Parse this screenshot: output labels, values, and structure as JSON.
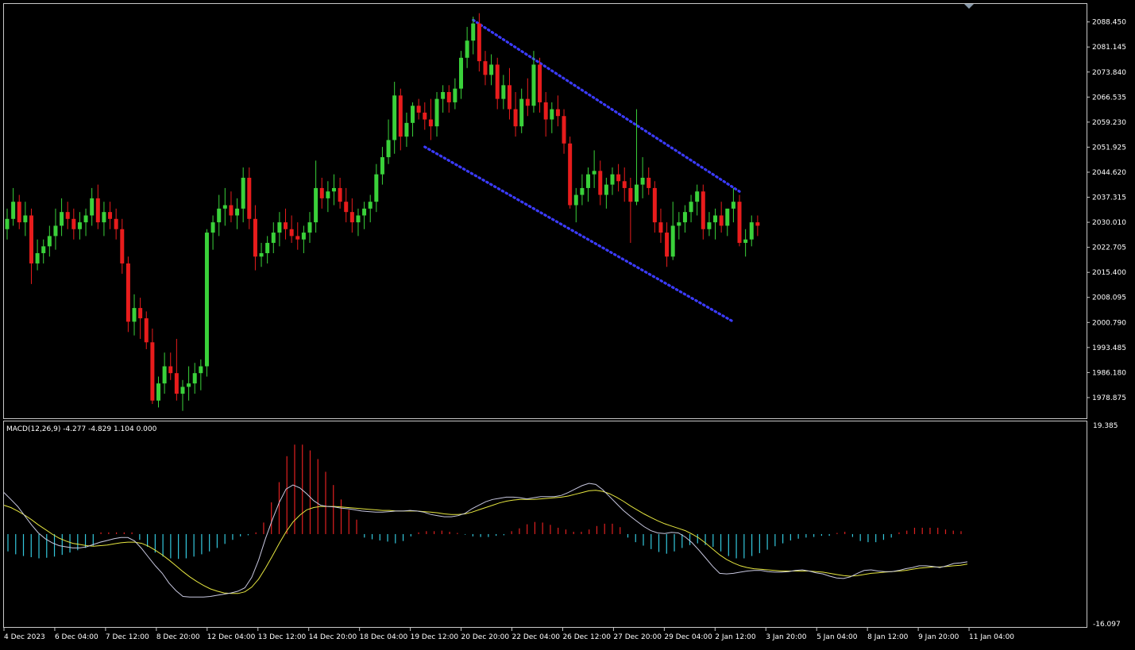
{
  "chart_data": [
    {
      "type": "candlestick",
      "symbol_panel": "price",
      "ylim": [
        1974.0,
        2093.0
      ],
      "y_ticks": [
        "2088.450",
        "2081.145",
        "2073.840",
        "2066.535",
        "2059.230",
        "2051.925",
        "2044.620",
        "2037.315",
        "2030.010",
        "2022.705",
        "2015.400",
        "2008.095",
        "2000.790",
        "1993.485",
        "1986.180",
        "1978.875"
      ],
      "x_labels": [
        "4 Dec 2023",
        "6 Dec 04:00",
        "7 Dec 12:00",
        "8 Dec 20:00",
        "12 Dec 04:00",
        "13 Dec 12:00",
        "14 Dec 20:00",
        "18 Dec 04:00",
        "19 Dec 12:00",
        "20 Dec 20:00",
        "22 Dec 04:00",
        "26 Dec 12:00",
        "27 Dec 20:00",
        "29 Dec 04:00",
        "2 Jan 12:00",
        "3 Jan 20:00",
        "5 Jan 04:00",
        "8 Jan 12:00",
        "9 Jan 20:00",
        "11 Jan 04:00"
      ],
      "bull_color": "#3ad13a",
      "bear_color": "#e81c1c",
      "ohlc": [
        [
          2028,
          2034,
          2025,
          2031
        ],
        [
          2031,
          2040,
          2029,
          2036
        ],
        [
          2036,
          2038,
          2028,
          2030
        ],
        [
          2030,
          2036,
          2026,
          2032
        ],
        [
          2032,
          2034,
          2012,
          2018
        ],
        [
          2018,
          2025,
          2016,
          2021
        ],
        [
          2021,
          2025,
          2018,
          2023
        ],
        [
          2023,
          2029,
          2020,
          2026
        ],
        [
          2026,
          2034,
          2022,
          2029
        ],
        [
          2029,
          2037,
          2026,
          2033
        ],
        [
          2033,
          2036,
          2028,
          2031
        ],
        [
          2031,
          2034,
          2025,
          2028
        ],
        [
          2028,
          2033,
          2025,
          2030
        ],
        [
          2030,
          2034,
          2026,
          2032
        ],
        [
          2032,
          2040,
          2029,
          2037
        ],
        [
          2037,
          2041,
          2028,
          2030
        ],
        [
          2030,
          2036,
          2026,
          2033
        ],
        [
          2033,
          2036,
          2028,
          2031
        ],
        [
          2031,
          2034,
          2025,
          2028
        ],
        [
          2028,
          2031,
          2015,
          2018
        ],
        [
          2018,
          2020,
          1998,
          2001
        ],
        [
          2001,
          2009,
          1997,
          2005
        ],
        [
          2005,
          2008,
          1996,
          2002
        ],
        [
          2002,
          2004,
          1993,
          1995
        ],
        [
          1995,
          1999,
          1977,
          1978
        ],
        [
          1978,
          1985,
          1976,
          1983
        ],
        [
          1983,
          1992,
          1980,
          1988
        ],
        [
          1988,
          1992,
          1984,
          1986
        ],
        [
          1986,
          1996,
          1978,
          1980
        ],
        [
          1980,
          1984,
          1975,
          1982
        ],
        [
          1982,
          1988,
          1978,
          1983
        ],
        [
          1983,
          1989,
          1980,
          1986
        ],
        [
          1986,
          1990,
          1981,
          1988
        ],
        [
          1988,
          2028,
          1985,
          2027
        ],
        [
          2027,
          2032,
          2022,
          2030
        ],
        [
          2030,
          2038,
          2026,
          2034
        ],
        [
          2034,
          2040,
          2029,
          2035
        ],
        [
          2035,
          2039,
          2030,
          2032
        ],
        [
          2032,
          2037,
          2028,
          2034
        ],
        [
          2034,
          2046,
          2030,
          2043
        ],
        [
          2043,
          2046,
          2028,
          2031
        ],
        [
          2031,
          2035,
          2016,
          2020
        ],
        [
          2020,
          2024,
          2017,
          2021
        ],
        [
          2021,
          2026,
          2018,
          2024
        ],
        [
          2024,
          2030,
          2021,
          2027
        ],
        [
          2027,
          2033,
          2023,
          2030
        ],
        [
          2030,
          2034,
          2025,
          2028
        ],
        [
          2028,
          2032,
          2024,
          2026
        ],
        [
          2026,
          2030,
          2022,
          2025
        ],
        [
          2025,
          2029,
          2021,
          2027
        ],
        [
          2027,
          2033,
          2024,
          2030
        ],
        [
          2030,
          2048,
          2027,
          2040
        ],
        [
          2040,
          2043,
          2034,
          2037
        ],
        [
          2037,
          2042,
          2033,
          2039
        ],
        [
          2039,
          2044,
          2035,
          2040
        ],
        [
          2040,
          2043,
          2034,
          2036
        ],
        [
          2036,
          2040,
          2030,
          2033
        ],
        [
          2033,
          2037,
          2027,
          2030
        ],
        [
          2030,
          2034,
          2026,
          2032
        ],
        [
          2032,
          2036,
          2028,
          2034
        ],
        [
          2034,
          2038,
          2030,
          2036
        ],
        [
          2036,
          2047,
          2033,
          2044
        ],
        [
          2044,
          2052,
          2041,
          2049
        ],
        [
          2049,
          2060,
          2047,
          2054
        ],
        [
          2054,
          2071,
          2050,
          2067
        ],
        [
          2067,
          2069,
          2051,
          2055
        ],
        [
          2055,
          2062,
          2052,
          2059
        ],
        [
          2059,
          2065,
          2055,
          2064
        ],
        [
          2064,
          2066,
          2060,
          2062
        ],
        [
          2062,
          2065,
          2057,
          2060
        ],
        [
          2060,
          2066,
          2054,
          2058
        ],
        [
          2058,
          2068,
          2055,
          2066
        ],
        [
          2066,
          2070,
          2062,
          2068
        ],
        [
          2068,
          2070,
          2062,
          2065
        ],
        [
          2065,
          2072,
          2063,
          2069
        ],
        [
          2069,
          2080,
          2066,
          2078
        ],
        [
          2078,
          2087,
          2075,
          2083
        ],
        [
          2083,
          2090,
          2079,
          2088
        ],
        [
          2088,
          2091,
          2074,
          2077
        ],
        [
          2077,
          2080,
          2070,
          2073
        ],
        [
          2073,
          2079,
          2070,
          2076
        ],
        [
          2076,
          2078,
          2063,
          2066
        ],
        [
          2066,
          2073,
          2063,
          2070
        ],
        [
          2070,
          2075,
          2060,
          2063
        ],
        [
          2063,
          2068,
          2055,
          2058
        ],
        [
          2058,
          2069,
          2056,
          2066
        ],
        [
          2066,
          2072,
          2061,
          2064
        ],
        [
          2064,
          2080,
          2062,
          2076
        ],
        [
          2076,
          2078,
          2062,
          2065
        ],
        [
          2065,
          2068,
          2055,
          2060
        ],
        [
          2060,
          2065,
          2056,
          2063
        ],
        [
          2063,
          2067,
          2058,
          2061
        ],
        [
          2061,
          2063,
          2050,
          2053
        ],
        [
          2053,
          2055,
          2034,
          2035
        ],
        [
          2035,
          2040,
          2030,
          2038
        ],
        [
          2038,
          2044,
          2035,
          2040
        ],
        [
          2040,
          2046,
          2036,
          2044
        ],
        [
          2044,
          2051,
          2040,
          2045
        ],
        [
          2045,
          2048,
          2035,
          2038
        ],
        [
          2038,
          2043,
          2034,
          2041
        ],
        [
          2041,
          2046,
          2038,
          2044
        ],
        [
          2044,
          2047,
          2039,
          2042
        ],
        [
          2042,
          2046,
          2036,
          2040
        ],
        [
          2040,
          2043,
          2024,
          2036
        ],
        [
          2036,
          2063,
          2035,
          2041
        ],
        [
          2041,
          2049,
          2037,
          2043
        ],
        [
          2043,
          2046,
          2038,
          2040
        ],
        [
          2040,
          2042,
          2027,
          2030
        ],
        [
          2030,
          2034,
          2024,
          2027
        ],
        [
          2027,
          2030,
          2017,
          2020
        ],
        [
          2020,
          2036,
          2019,
          2029
        ],
        [
          2029,
          2033,
          2025,
          2030
        ],
        [
          2030,
          2035,
          2027,
          2033
        ],
        [
          2033,
          2038,
          2030,
          2036
        ],
        [
          2036,
          2041,
          2032,
          2039
        ],
        [
          2039,
          2041,
          2025,
          2028
        ],
        [
          2028,
          2033,
          2026,
          2030
        ],
        [
          2030,
          2034,
          2025,
          2032
        ],
        [
          2032,
          2036,
          2027,
          2029
        ],
        [
          2029,
          2033,
          2026,
          2034
        ],
        [
          2034,
          2040,
          2030,
          2036
        ],
        [
          2036,
          2038,
          2023,
          2024
        ],
        [
          2024,
          2028,
          2020,
          2025
        ],
        [
          2025,
          2032,
          2023,
          2030
        ],
        [
          2030,
          2032,
          2026,
          2029
        ]
      ],
      "channel": {
        "color": "#3b3bff",
        "upper": [
          [
            77,
            2089
          ],
          [
            121,
            2039
          ]
        ],
        "lower": [
          [
            69,
            2052
          ],
          [
            120,
            2001
          ]
        ]
      }
    },
    {
      "type": "macd",
      "title": "MACD(12,26,9) -4.277 -4.829 1.104 0.000",
      "ylim": [
        -16.097,
        19.385
      ],
      "y_top_label": "19.385",
      "y_bottom_label": "-16.097",
      "hist_pos_color": "#e02020",
      "hist_neg_color": "#33c8dd",
      "macd_line_color": "#c8c8e0",
      "signal_line_color": "#e6e640",
      "histogram": [
        -3.0,
        -3.5,
        -3.8,
        -4.0,
        -4.2,
        -4.1,
        -3.9,
        -3.6,
        -3.2,
        -2.8,
        -2.4,
        -2.0,
        0.3,
        0.3,
        0.3,
        0.3,
        0.3,
        -1.0,
        -2.2,
        -3.2,
        -3.9,
        -4.2,
        -4.3,
        -4.2,
        -3.9,
        -3.5,
        -3.0,
        -2.4,
        -1.7,
        -1.0,
        -0.4,
        -0.2,
        0.3,
        2.0,
        5.5,
        9.0,
        13.5,
        15.5,
        15.5,
        14.5,
        13.0,
        10.8,
        8.5,
        6.0,
        4.2,
        2.5,
        -0.6,
        -0.9,
        -1.1,
        -1.3,
        -1.6,
        -1.2,
        -0.4,
        0.3,
        0.5,
        0.5,
        0.6,
        0.4,
        0.2,
        -0.1,
        -0.4,
        -0.5,
        -0.5,
        -0.3,
        -0.2,
        0.5,
        1.0,
        1.7,
        2.1,
        2.0,
        1.6,
        1.1,
        0.8,
        0.4,
        0.4,
        0.8,
        1.4,
        1.8,
        1.8,
        1.2,
        -0.6,
        -1.4,
        -2.0,
        -2.6,
        -3.1,
        -3.4,
        -3.0,
        -2.4,
        -1.9,
        -1.6,
        -1.9,
        -2.2,
        -3.0,
        -3.8,
        -4.2,
        -4.2,
        -3.8,
        -3.3,
        -2.7,
        -2.1,
        -1.6,
        -1.1,
        -0.8,
        -0.6,
        -0.5,
        -0.3,
        -0.3,
        0.2,
        0.4,
        -0.5,
        -1.2,
        -1.4,
        -1.4,
        -1.0,
        -0.6,
        0.3,
        0.6,
        1.1,
        1.1,
        1.1,
        1.1,
        0.8,
        0.6,
        0.5
      ],
      "macd": [
        7.2,
        6.0,
        4.8,
        3.2,
        1.6,
        0.2,
        -0.8,
        -1.5,
        -2.0,
        -2.2,
        -2.4,
        -2.4,
        -2.2,
        -1.8,
        -1.4,
        -1.1,
        -0.8,
        -0.6,
        -0.6,
        -1.2,
        -2.5,
        -4.0,
        -5.5,
        -6.8,
        -8.5,
        -9.8,
        -10.8,
        -10.9,
        -10.9,
        -10.9,
        -10.8,
        -10.6,
        -10.4,
        -10.2,
        -9.9,
        -9.3,
        -7.5,
        -4.5,
        -0.8,
        2.5,
        5.5,
        7.8,
        8.5,
        8.0,
        7.0,
        5.8,
        5.0,
        4.8,
        4.7,
        4.5,
        4.4,
        4.2,
        4.0,
        3.9,
        3.8,
        3.8,
        3.9,
        4.0,
        4.0,
        4.1,
        4.0,
        3.8,
        3.4,
        3.2,
        3.0,
        3.0,
        3.2,
        3.6,
        4.4,
        5.0,
        5.6,
        6.0,
        6.2,
        6.4,
        6.4,
        6.3,
        6.1,
        6.3,
        6.5,
        6.5,
        6.5,
        6.7,
        7.2,
        7.8,
        8.4,
        8.8,
        8.6,
        7.7,
        6.5,
        5.3,
        4.1,
        3.1,
        2.2,
        1.3,
        0.6,
        0.2,
        0.1,
        0.3,
        0.2,
        -0.5,
        -1.5,
        -2.8,
        -4.2,
        -5.6,
        -6.8,
        -6.9,
        -6.8,
        -6.6,
        -6.4,
        -6.3,
        -6.3,
        -6.5,
        -6.6,
        -6.6,
        -6.5,
        -6.3,
        -6.2,
        -6.4,
        -6.7,
        -6.9,
        -7.3,
        -7.6,
        -7.7,
        -7.4,
        -6.8,
        -6.3,
        -6.2,
        -6.4,
        -6.5,
        -6.5,
        -6.3,
        -6.0,
        -5.8,
        -5.5,
        -5.5,
        -5.6,
        -5.8,
        -5.5,
        -5.1,
        -5.0,
        -4.8
      ],
      "signal": [
        5.0,
        4.6,
        4.0,
        3.3,
        2.5,
        1.6,
        0.8,
        0.0,
        -0.7,
        -1.2,
        -1.6,
        -1.8,
        -2.0,
        -2.1,
        -2.0,
        -1.9,
        -1.7,
        -1.5,
        -1.4,
        -1.4,
        -1.6,
        -2.1,
        -2.8,
        -3.6,
        -4.5,
        -5.5,
        -6.5,
        -7.4,
        -8.2,
        -8.9,
        -9.5,
        -9.9,
        -10.2,
        -10.3,
        -10.3,
        -10.0,
        -9.2,
        -7.8,
        -5.9,
        -3.8,
        -1.6,
        0.4,
        2.1,
        3.3,
        4.2,
        4.6,
        4.8,
        4.8,
        4.8,
        4.7,
        4.6,
        4.5,
        4.4,
        4.3,
        4.2,
        4.1,
        4.1,
        4.0,
        4.0,
        4.0,
        4.0,
        3.9,
        3.8,
        3.7,
        3.5,
        3.4,
        3.4,
        3.5,
        3.8,
        4.2,
        4.6,
        5.0,
        5.4,
        5.7,
        5.9,
        6.0,
        6.0,
        6.0,
        6.1,
        6.2,
        6.3,
        6.4,
        6.6,
        6.9,
        7.2,
        7.5,
        7.6,
        7.4,
        7.0,
        6.4,
        5.7,
        4.9,
        4.2,
        3.5,
        2.9,
        2.3,
        1.8,
        1.4,
        1.0,
        0.6,
        0.0,
        -0.7,
        -1.6,
        -2.6,
        -3.6,
        -4.4,
        -5.0,
        -5.5,
        -5.8,
        -6.0,
        -6.1,
        -6.2,
        -6.3,
        -6.4,
        -6.4,
        -6.4,
        -6.4,
        -6.4,
        -6.5,
        -6.6,
        -6.8,
        -7.0,
        -7.2,
        -7.3,
        -7.2,
        -7.0,
        -6.8,
        -6.7,
        -6.6,
        -6.5,
        -6.4,
        -6.3,
        -6.1,
        -5.9,
        -5.8,
        -5.7,
        -5.7,
        -5.6,
        -5.5,
        -5.4,
        -5.2
      ]
    }
  ]
}
